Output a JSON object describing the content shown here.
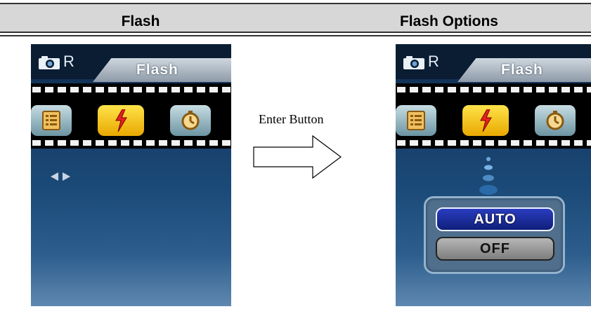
{
  "header": {
    "left_title": "Flash",
    "right_title": "Flash Options"
  },
  "screens": {
    "mode_letter": "R",
    "tab_label": "Flash"
  },
  "transition": {
    "label": "Enter Button"
  },
  "flash_options": [
    {
      "label": "AUTO",
      "selected": true
    },
    {
      "label": "OFF",
      "selected": false
    }
  ],
  "icons": {
    "camera": "camera-icon",
    "menu": "menu-list-icon",
    "flash": "flash-icon",
    "timer": "self-timer-icon",
    "nav": "left-right-arrows-icon"
  },
  "colors": {
    "selected_button": "#f5c400",
    "flash_bolt": "#e52020",
    "auto_highlight": "#1a2fa8"
  }
}
